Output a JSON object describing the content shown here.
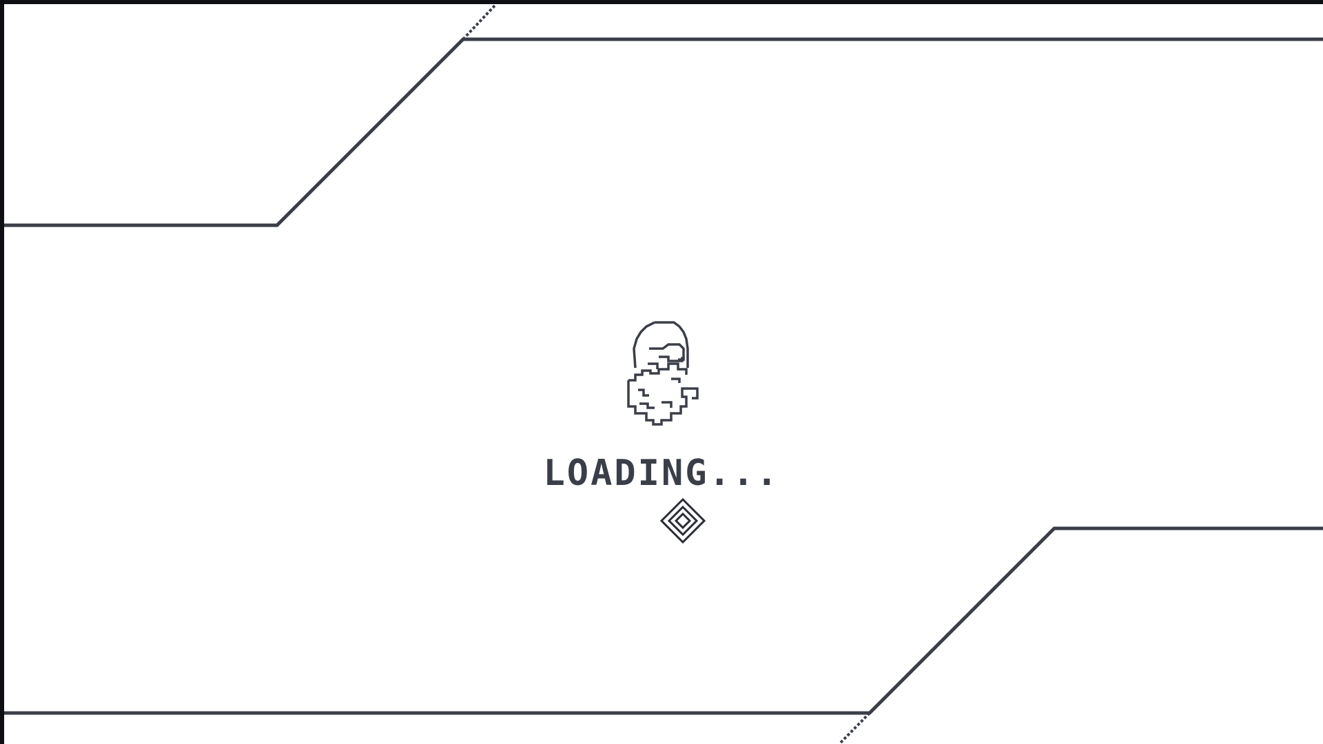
{
  "loading": {
    "text": "LOADING..."
  },
  "icons": {
    "avatar": "bearded-face-icon",
    "spinner": "diamond-spinner-icon"
  },
  "colors": {
    "background": "#ffffff",
    "line": "#3a3e48",
    "frame": "#0d0f12"
  }
}
